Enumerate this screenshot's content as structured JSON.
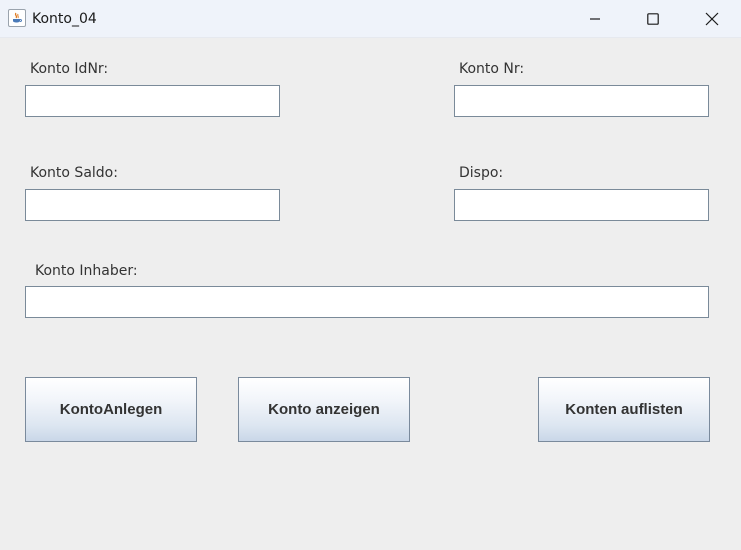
{
  "window": {
    "title": "Konto_04",
    "controls": {
      "minimize": "minimize-icon",
      "maximize": "maximize-icon",
      "close": "close-icon"
    },
    "icon": "java-app-icon"
  },
  "form": {
    "konto_idnr": {
      "label": "Konto IdNr:",
      "value": ""
    },
    "konto_nr": {
      "label": "Konto Nr:",
      "value": ""
    },
    "konto_saldo": {
      "label": "Konto Saldo:",
      "value": ""
    },
    "dispo": {
      "label": "Dispo:",
      "value": ""
    },
    "konto_inhaber": {
      "label": "Konto Inhaber:",
      "value": ""
    }
  },
  "buttons": {
    "konto_anlegen": "KontoAnlegen",
    "konto_anzeigen": "Konto anzeigen",
    "konten_auflisten": "Konten auflisten"
  },
  "colors": {
    "background": "#eeeeee",
    "titlebar": "#eff3fa",
    "field_border": "#7a8a99",
    "button_gradient_top": "#ffffff",
    "button_gradient_bottom": "#c9d7e8"
  }
}
